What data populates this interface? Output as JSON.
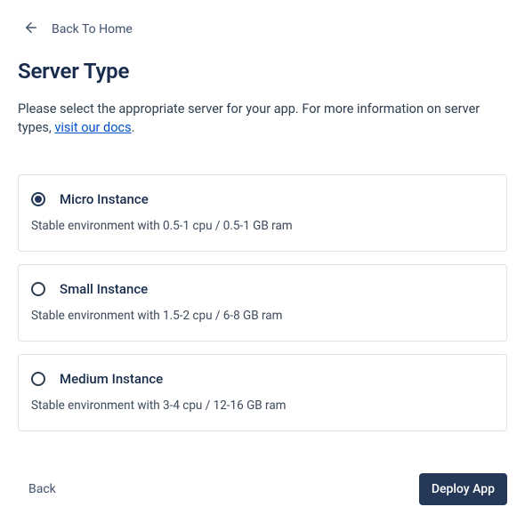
{
  "nav": {
    "back_home": "Back To Home"
  },
  "page": {
    "title": "Server Type",
    "description_prefix": "Please select the appropriate server for your app. For more information on server types, ",
    "docs_link_text": "visit our docs",
    "description_suffix": "."
  },
  "options": [
    {
      "title": "Micro Instance",
      "description": "Stable environment with 0.5-1 cpu / 0.5-1 GB ram",
      "selected": true
    },
    {
      "title": "Small Instance",
      "description": "Stable environment with 1.5-2 cpu / 6-8 GB ram",
      "selected": false
    },
    {
      "title": "Medium Instance",
      "description": "Stable environment with 3-4 cpu / 12-16 GB ram",
      "selected": false
    }
  ],
  "footer": {
    "back_label": "Back",
    "deploy_label": "Deploy App"
  }
}
